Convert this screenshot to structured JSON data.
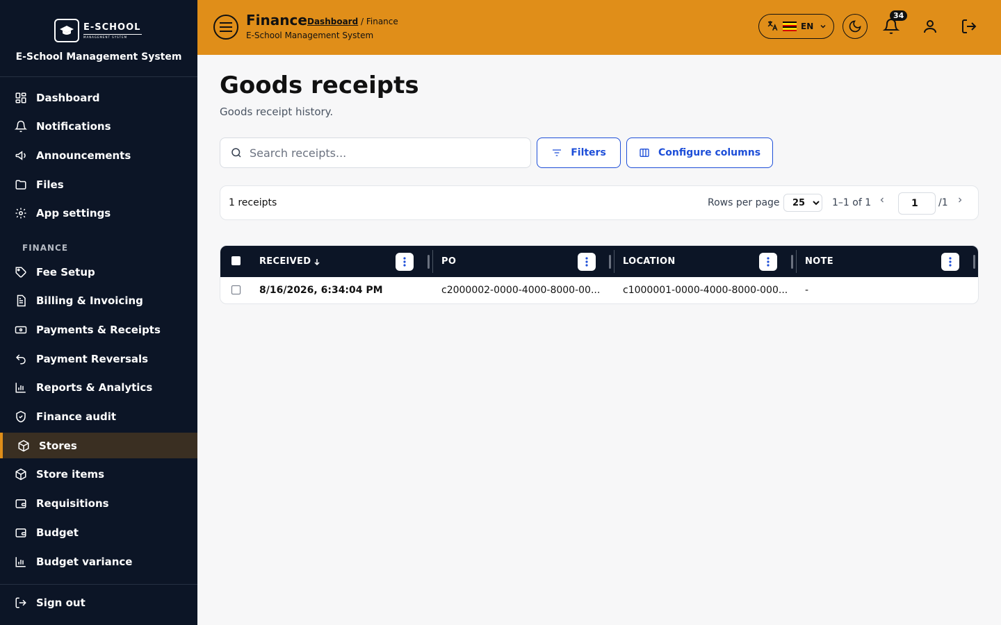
{
  "sidebar": {
    "logo": {
      "name": "E-SCHOOL",
      "sub": "MANAGEMENT SYSTEM"
    },
    "title": "E-School Management System",
    "items_top": [
      {
        "label": "Dashboard",
        "icon": "dashboard-grid-icon"
      },
      {
        "label": "Notifications",
        "icon": "bell-icon"
      },
      {
        "label": "Announcements",
        "icon": "megaphone-icon"
      },
      {
        "label": "Files",
        "icon": "folder-icon"
      },
      {
        "label": "App settings",
        "icon": "gear-icon"
      }
    ],
    "section_label": "FINANCE",
    "items_finance": [
      {
        "label": "Fee Setup",
        "icon": "tag-icon"
      },
      {
        "label": "Billing & Invoicing",
        "icon": "invoice-icon"
      },
      {
        "label": "Payments & Receipts",
        "icon": "banknote-icon"
      },
      {
        "label": "Payment Reversals",
        "icon": "undo-icon"
      },
      {
        "label": "Reports & Analytics",
        "icon": "bar-chart-icon"
      },
      {
        "label": "Finance audit",
        "icon": "shield-check-icon"
      },
      {
        "label": "Stores",
        "icon": "package-icon",
        "active": true
      },
      {
        "label": "Store items",
        "icon": "package-icon"
      },
      {
        "label": "Requisitions",
        "icon": "wallet-icon"
      },
      {
        "label": "Budget",
        "icon": "wallet-icon"
      },
      {
        "label": "Budget variance",
        "icon": "bar-chart-icon"
      }
    ],
    "signout": {
      "label": "Sign out",
      "icon": "sign-out-icon"
    }
  },
  "header": {
    "title": "Finance",
    "breadcrumb_link": "Dashboard",
    "breadcrumb_rest": " / Finance",
    "subtitle": "E-School Management System",
    "language": "EN",
    "notification_count": "34",
    "accent_color": "#e08e19"
  },
  "main": {
    "title": "Goods receipts",
    "subtitle": "Goods receipt history.",
    "search_placeholder": "Search receipts...",
    "filters_label": "Filters",
    "configure_label": "Configure columns",
    "pager": {
      "count": "1 receipts",
      "rows_per_page_label": "Rows per page",
      "rows_per_page": "25",
      "range": "1–1 of 1",
      "page": "1",
      "total_pages": "/1"
    },
    "table": {
      "columns": [
        "RECEIVED",
        "PO",
        "LOCATION",
        "NOTE"
      ],
      "rows": [
        [
          "8/16/2026, 6:34:04 PM",
          "c2000002-0000-4000-8000-00...",
          "c1000001-0000-4000-8000-000...",
          "-"
        ]
      ]
    }
  }
}
